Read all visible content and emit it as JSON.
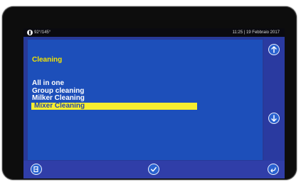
{
  "status": {
    "angle": "92°/145°",
    "time_date": "11:25 | 19 Febbraio 2017"
  },
  "screen": {
    "title": "Cleaning"
  },
  "menu": {
    "items": [
      {
        "label": "All in one",
        "selected": false
      },
      {
        "label": "Group cleaning",
        "selected": false
      },
      {
        "label": "Milker Cleaning",
        "selected": false
      },
      {
        "label": "Mixer Cleaning",
        "selected": true
      }
    ]
  },
  "icons": {
    "scroll_up": "arrow-up-icon",
    "scroll_down": "arrow-down-icon",
    "exit": "exit-door-icon",
    "confirm": "checkmark-icon",
    "back": "back-arrow-icon",
    "status": "info-icon"
  },
  "colors": {
    "title": "#f2e300",
    "selection": "#f6ee2f",
    "background": "#283a98",
    "panel": "#1d4fba"
  }
}
